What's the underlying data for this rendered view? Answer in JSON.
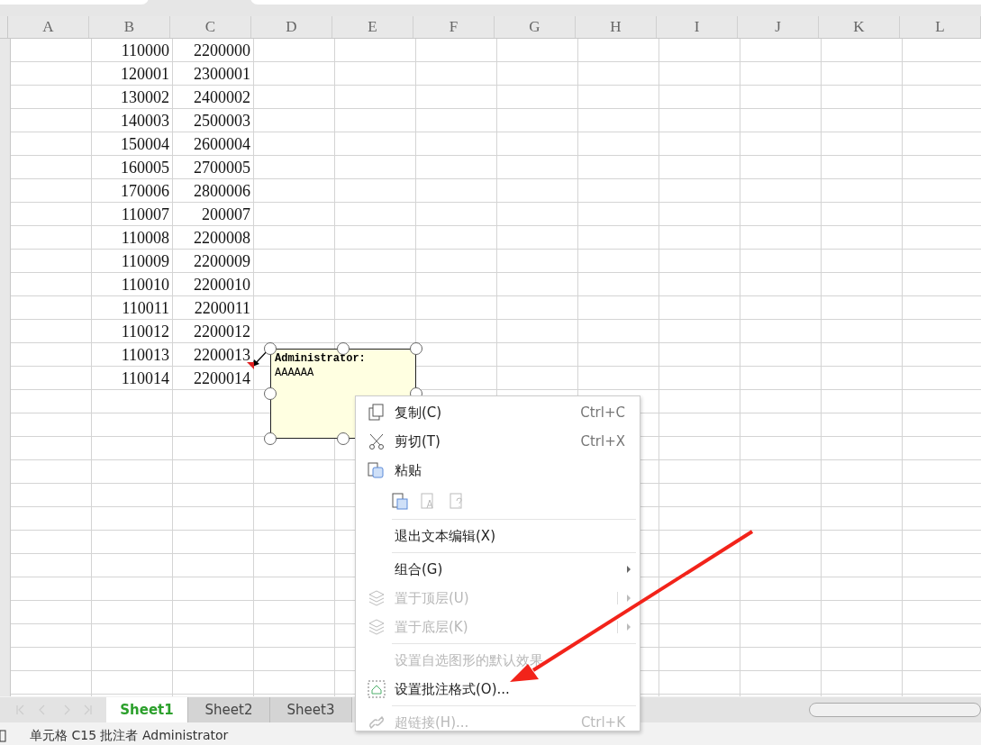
{
  "columns": [
    "A",
    "B",
    "C",
    "D",
    "E",
    "F",
    "G",
    "H",
    "I",
    "J",
    "K",
    "L"
  ],
  "rows": [
    [
      "110000",
      "2200000"
    ],
    [
      "120001",
      "2300001"
    ],
    [
      "130002",
      "2400002"
    ],
    [
      "140003",
      "2500003"
    ],
    [
      "150004",
      "2600004"
    ],
    [
      "160005",
      "2700005"
    ],
    [
      "170006",
      "2800006"
    ],
    [
      "110007",
      "200007"
    ],
    [
      "110008",
      "2200008"
    ],
    [
      "110009",
      "2200009"
    ],
    [
      "110010",
      "2200010"
    ],
    [
      "110011",
      "2200011"
    ],
    [
      "110012",
      "2200012"
    ],
    [
      "110013",
      "2200013"
    ],
    [
      "110014",
      "2200014"
    ]
  ],
  "comment": {
    "author": "Administrator:",
    "text": "AAAAAA"
  },
  "context_menu": [
    {
      "kind": "item",
      "label": "复制(C)",
      "shortcut": "Ctrl+C",
      "disabled": false,
      "submenu": false
    },
    {
      "kind": "item",
      "label": "剪切(T)",
      "shortcut": "Ctrl+X",
      "disabled": false,
      "submenu": false
    },
    {
      "kind": "item",
      "label": "粘贴",
      "disabled": false,
      "submenu": false
    },
    {
      "kind": "paste-options"
    },
    {
      "kind": "separator"
    },
    {
      "kind": "item",
      "label": "退出文本编辑(X)",
      "disabled": false,
      "submenu": false
    },
    {
      "kind": "separator"
    },
    {
      "kind": "item",
      "label": "组合(G)",
      "disabled": false,
      "submenu": true
    },
    {
      "kind": "item",
      "label": "置于顶层(U)",
      "disabled": true,
      "submenu": true
    },
    {
      "kind": "item",
      "label": "置于底层(K)",
      "disabled": true,
      "submenu": true
    },
    {
      "kind": "separator"
    },
    {
      "kind": "item",
      "label": "设置自选图形的默认效果",
      "disabled": true,
      "submenu": false
    },
    {
      "kind": "item",
      "label": "设置批注格式(O)...",
      "disabled": false,
      "submenu": false
    },
    {
      "kind": "separator"
    },
    {
      "kind": "item",
      "label": "超链接(H)...",
      "shortcut": "Ctrl+K",
      "disabled": true,
      "submenu": false
    }
  ],
  "sheet_tabs": [
    {
      "label": "Sheet1",
      "selected": true
    },
    {
      "label": "Sheet2",
      "selected": false
    },
    {
      "label": "Sheet3",
      "selected": false
    }
  ],
  "status_bar": "单元格 C15 批注者 Administrator"
}
